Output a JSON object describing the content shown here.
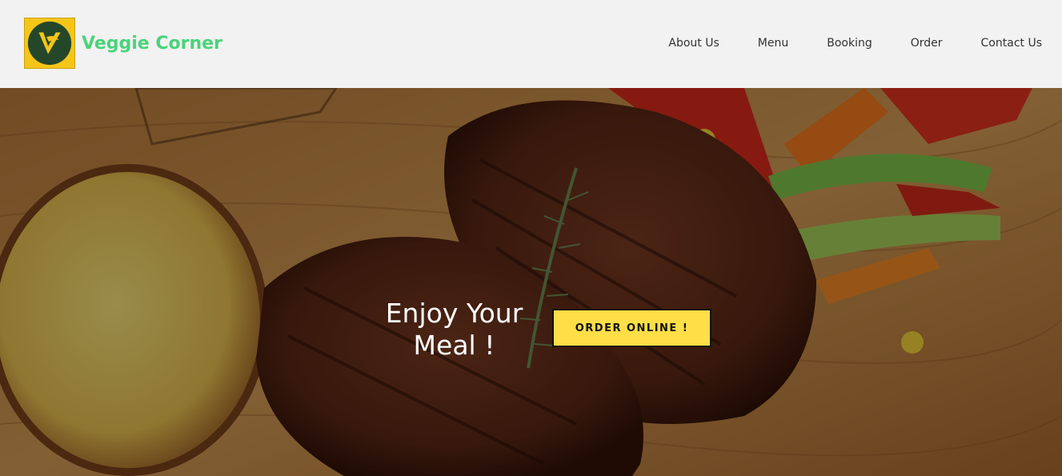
{
  "brand": {
    "name": "Veggie Corner",
    "logo_icon": "veggie-corner-logo",
    "name_color": "#4bd37a",
    "logo_bg": "#f5c518"
  },
  "nav": {
    "items": [
      {
        "label": "About Us"
      },
      {
        "label": "Menu"
      },
      {
        "label": "Booking"
      },
      {
        "label": "Order"
      },
      {
        "label": "Contact Us"
      }
    ]
  },
  "hero": {
    "image": "grilled-steak-with-potato-and-vegetables",
    "headline": "Enjoy Your Meal !",
    "cta_label": "ORDER ONLINE !",
    "cta_color": "#ffde47"
  }
}
